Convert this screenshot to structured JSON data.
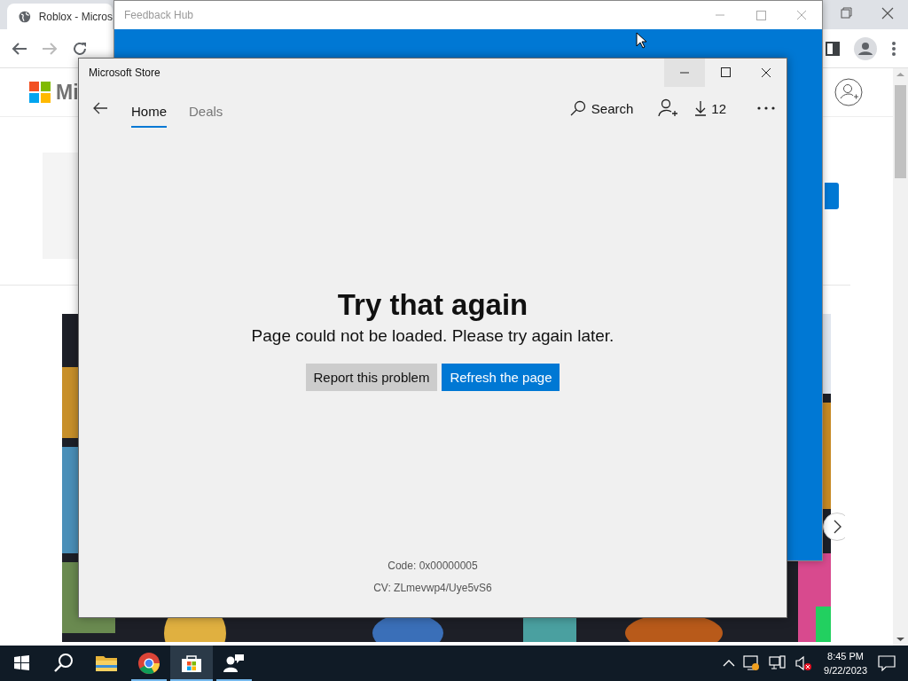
{
  "browser": {
    "tab_title": "Roblox - Micros",
    "page": {
      "logo_text": "Mi"
    }
  },
  "feedback_window": {
    "title": "Feedback Hub"
  },
  "store_window": {
    "title": "Microsoft Store",
    "tabs": [
      {
        "label": "Home",
        "selected": true
      },
      {
        "label": "Deals",
        "selected": false
      }
    ],
    "search_label": "Search",
    "downloads_count": "12",
    "error": {
      "heading": "Try that again",
      "message": "Page could not be loaded. Please try again later.",
      "buttons": [
        {
          "label": "Report this problem",
          "kind": "secondary"
        },
        {
          "label": "Refresh the page",
          "kind": "primary"
        }
      ],
      "code": "Code: 0x00000005",
      "cv": "CV: ZLmevwp4/Uye5vS6"
    }
  },
  "taskbar": {
    "apps": [
      {
        "kind": "explorer",
        "open": false,
        "selected": false
      },
      {
        "kind": "chrome",
        "open": true,
        "selected": false
      },
      {
        "kind": "store",
        "open": true,
        "selected": true
      },
      {
        "kind": "feedback",
        "open": true,
        "selected": false
      }
    ],
    "time": "8:45 PM",
    "date": "9/22/2023"
  }
}
